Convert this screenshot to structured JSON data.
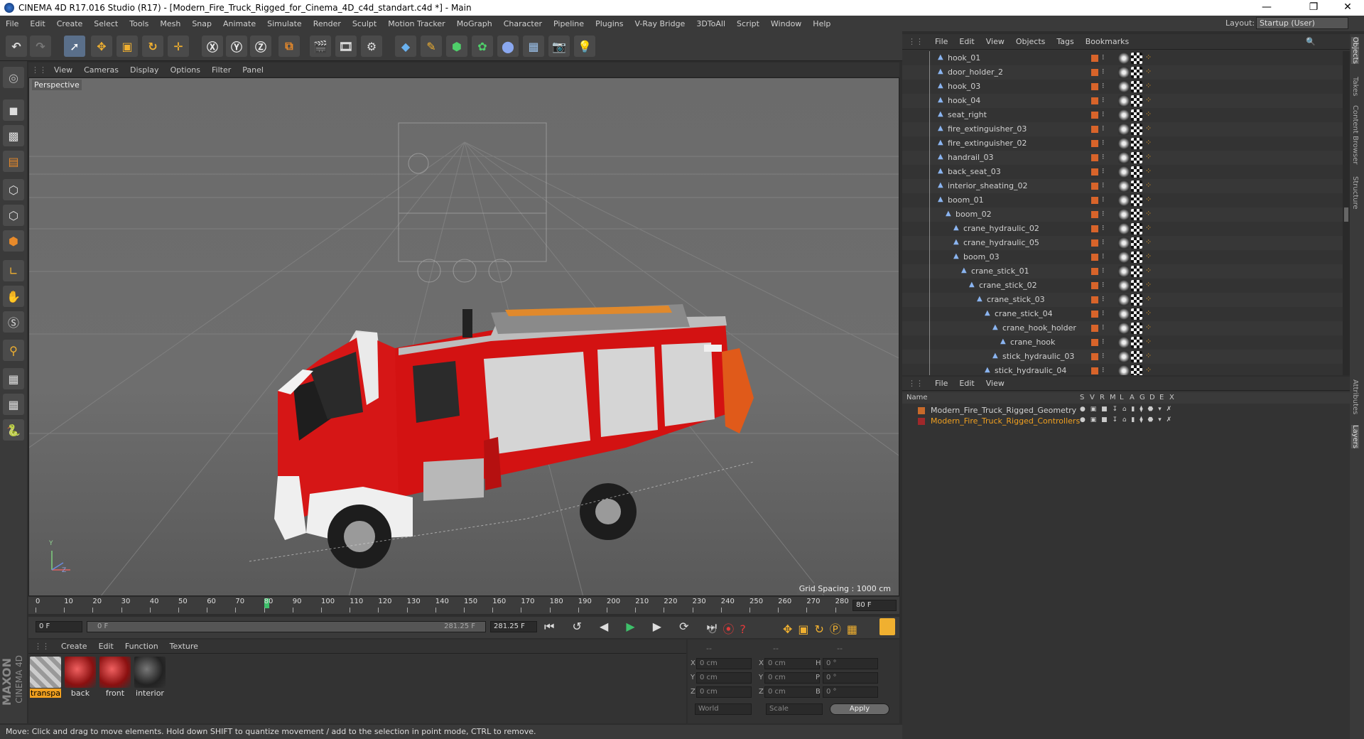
{
  "title": "CINEMA 4D R17.016 Studio (R17) - [Modern_Fire_Truck_Rigged_for_Cinema_4D_c4d_standart.c4d *] - Main",
  "menu": [
    "File",
    "Edit",
    "Create",
    "Select",
    "Tools",
    "Mesh",
    "Snap",
    "Animate",
    "Simulate",
    "Render",
    "Sculpt",
    "Motion Tracker",
    "MoGraph",
    "Character",
    "Pipeline",
    "Plugins",
    "V-Ray Bridge",
    "3DToAll",
    "Script",
    "Window",
    "Help"
  ],
  "layout": {
    "label": "Layout:",
    "value": "Startup (User)"
  },
  "viewport": {
    "menu": [
      "View",
      "Cameras",
      "Display",
      "Options",
      "Filter",
      "Panel"
    ],
    "camera_label": "Perspective",
    "grid_spacing": "Grid Spacing : 1000 cm"
  },
  "timeline": {
    "ticks": [
      "0",
      "10",
      "20",
      "30",
      "40",
      "50",
      "60",
      "70",
      "80",
      "90",
      "100",
      "110",
      "120",
      "130",
      "140",
      "150",
      "160",
      "170",
      "180",
      "190",
      "200",
      "210",
      "220",
      "230",
      "240",
      "250",
      "260",
      "270",
      "280"
    ],
    "current": 80,
    "end_field": "80 F"
  },
  "transport": {
    "start": "0 F",
    "range_start": "0 F",
    "range_end": "281.25 F",
    "end": "281.25 F"
  },
  "material_manager": {
    "menu": [
      "Create",
      "Edit",
      "Function",
      "Texture"
    ],
    "materials": [
      "transpa",
      "back",
      "front",
      "interior"
    ]
  },
  "attributes": {
    "headers": [
      "--",
      "--",
      "--"
    ],
    "rows": [
      {
        "a": "X",
        "av": "0 cm",
        "b": "X",
        "bv": "0 cm",
        "c": "H",
        "cv": "0 °"
      },
      {
        "a": "Y",
        "av": "0 cm",
        "b": "Y",
        "bv": "0 cm",
        "c": "P",
        "cv": "0 °"
      },
      {
        "a": "Z",
        "av": "0 cm",
        "b": "Z",
        "bv": "0 cm",
        "c": "B",
        "cv": "0 °"
      }
    ],
    "coord_mode": "World",
    "scale_mode": "Scale",
    "apply": "Apply"
  },
  "status": "Move: Click and drag to move elements. Hold down SHIFT to quantize movement / add to the selection in point mode, CTRL to remove.",
  "object_manager": {
    "menu": [
      "File",
      "Edit",
      "View",
      "Objects",
      "Tags",
      "Bookmarks"
    ],
    "rows": [
      {
        "name": "hook_01",
        "indent": 0
      },
      {
        "name": "door_holder_2",
        "indent": 0
      },
      {
        "name": "hook_03",
        "indent": 0
      },
      {
        "name": "hook_04",
        "indent": 0
      },
      {
        "name": "seat_right",
        "indent": 0
      },
      {
        "name": "fire_extinguisher_03",
        "indent": 0
      },
      {
        "name": "fire_extinguisher_02",
        "indent": 0
      },
      {
        "name": "handrail_03",
        "indent": 0
      },
      {
        "name": "back_seat_03",
        "indent": 0
      },
      {
        "name": "interior_sheating_02",
        "indent": 0
      },
      {
        "name": "boom_01",
        "indent": 0
      },
      {
        "name": "boom_02",
        "indent": 1
      },
      {
        "name": "crane_hydraulic_02",
        "indent": 2
      },
      {
        "name": "crane_hydraulic_05",
        "indent": 2
      },
      {
        "name": "boom_03",
        "indent": 2
      },
      {
        "name": "crane_stick_01",
        "indent": 3
      },
      {
        "name": "crane_stick_02",
        "indent": 4
      },
      {
        "name": "crane_stick_03",
        "indent": 5
      },
      {
        "name": "crane_stick_04",
        "indent": 6
      },
      {
        "name": "crane_hook_holder",
        "indent": 7
      },
      {
        "name": "crane_hook",
        "indent": 8
      },
      {
        "name": "stick_hydraulic_03",
        "indent": 7
      },
      {
        "name": "stick_hydraulic_04",
        "indent": 6
      }
    ]
  },
  "layer_manager": {
    "menu": [
      "File",
      "Edit",
      "View"
    ],
    "columns": [
      "Name",
      "S",
      "V",
      "R",
      "M",
      "L",
      "A",
      "G",
      "D",
      "E",
      "X"
    ],
    "layers": [
      {
        "name": "Modern_Fire_Truck_Rigged_Geometry",
        "color": "#c86a2a"
      },
      {
        "name": "Modern_Fire_Truck_Rigged_Controllers",
        "color": "#a0282a"
      }
    ]
  },
  "right_tabs": [
    "Objects",
    "Takes",
    "Content Browser",
    "Structure",
    "Attributes",
    "Layers"
  ],
  "brand": [
    "MAXON",
    "CINEMA 4D"
  ]
}
